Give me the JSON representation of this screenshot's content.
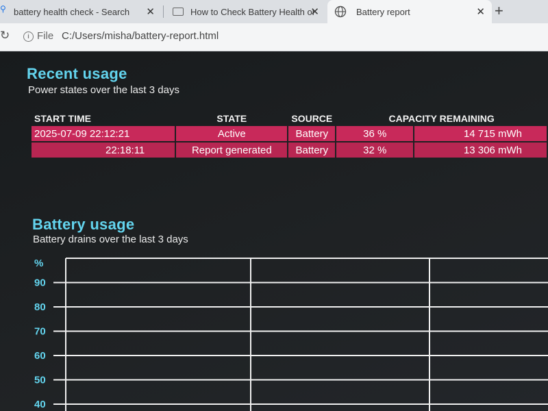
{
  "browser": {
    "tabs": [
      {
        "title": "battery health check - Search",
        "active": false
      },
      {
        "title": "How to Check Battery Health on W",
        "active": false
      },
      {
        "title": "Battery report",
        "active": true
      }
    ],
    "address": {
      "scheme_label": "File",
      "url": "C:/Users/misha/battery-report.html"
    }
  },
  "recent_usage": {
    "title": "Recent usage",
    "subtitle": "Power states over the last 3 days",
    "headers": [
      "START TIME",
      "STATE",
      "SOURCE",
      "CAPACITY REMAINING",
      ""
    ],
    "rows": [
      [
        "2025-07-09  22:12:21",
        "Active",
        "Battery",
        "36 %",
        "14 715 mWh"
      ],
      [
        "22:18:11",
        "Report generated",
        "Battery",
        "32 %",
        "13 306 mWh"
      ]
    ]
  },
  "battery_usage": {
    "title": "Battery usage",
    "subtitle": "Battery drains over the last 3 days"
  },
  "chart_data": {
    "type": "line",
    "ylabel": "%",
    "y_ticks": [
      "90",
      "80",
      "70",
      "60",
      "50",
      "40"
    ],
    "ylim": [
      40,
      100
    ],
    "grid": true,
    "series": []
  },
  "colors": {
    "heading": "#63d4ee",
    "row_accent": "#c8295a",
    "tick_label": "#63d4ee",
    "grid": "#f0f0f0"
  }
}
